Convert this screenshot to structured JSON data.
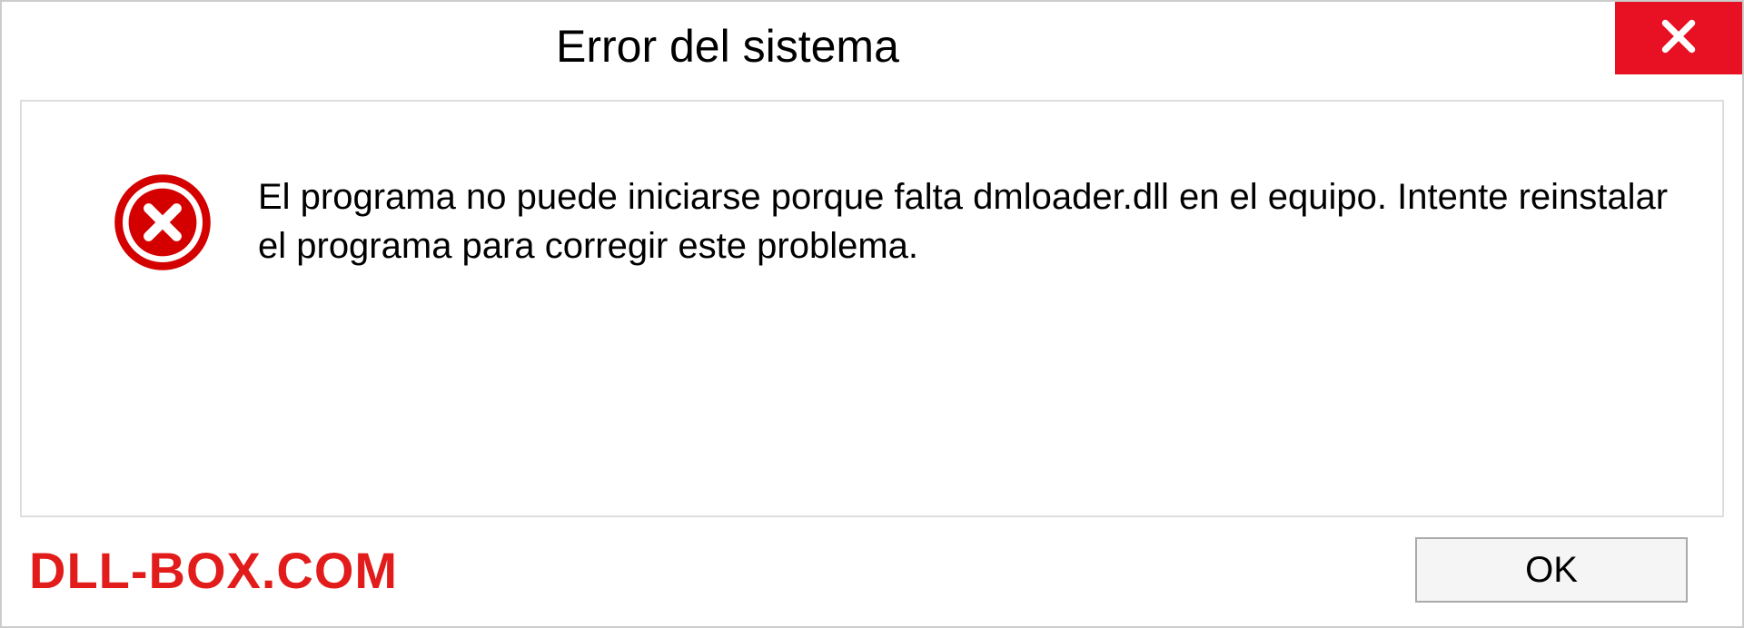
{
  "titlebar": {
    "title": "Error del sistema"
  },
  "content": {
    "message": "El programa no puede iniciarse porque falta dmloader.dll en el equipo. Intente reinstalar el programa para corregir este problema."
  },
  "footer": {
    "watermark": "DLL-BOX.COM",
    "ok_label": "OK"
  }
}
